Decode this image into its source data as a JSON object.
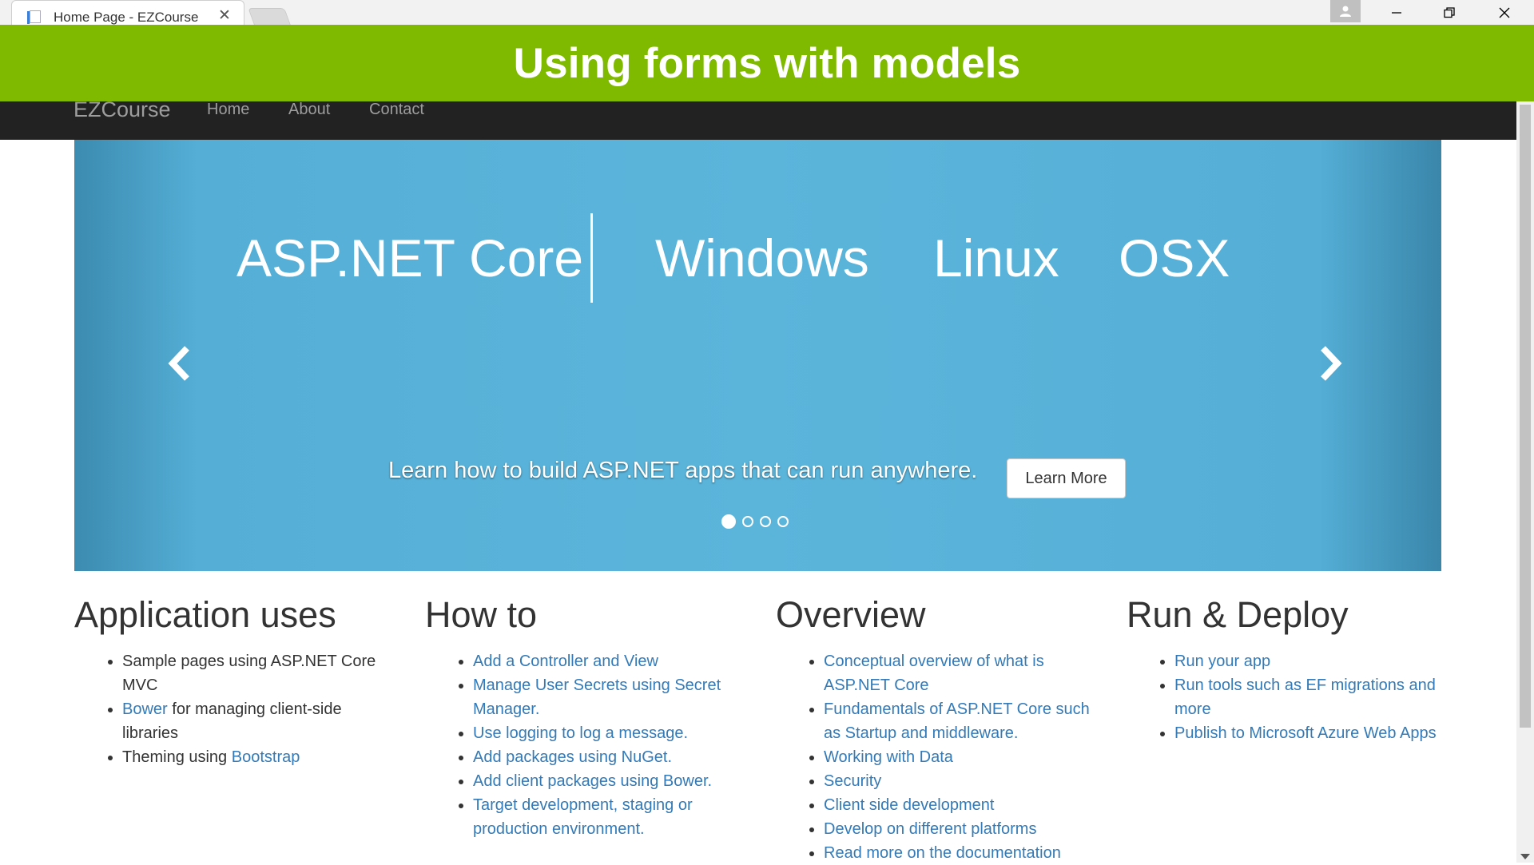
{
  "browser": {
    "tab_title": "Home Page - EZCourse",
    "tab_close": "✕"
  },
  "banner": {
    "title": "Using forms with models"
  },
  "navbar": {
    "brand": "EZCourse",
    "links": [
      "Home",
      "About",
      "Contact"
    ]
  },
  "carousel": {
    "headline": "ASP.NET Core",
    "platforms": [
      "Windows",
      "Linux",
      "OSX"
    ],
    "caption": "Learn how to build ASP.NET apps that can run anywhere.",
    "button_label": "Learn More",
    "slide_count": 4,
    "active_slide": 1
  },
  "sections": {
    "app_uses": {
      "title": "Application uses",
      "item1": "Sample pages using ASP.NET Core MVC",
      "item2_link": "Bower",
      "item2_rest": " for managing client-side libraries",
      "item3_text": "Theming using ",
      "item3_link": "Bootstrap"
    },
    "how_to": {
      "title": "How to",
      "items": [
        "Add a Controller and View",
        "Manage User Secrets using Secret Manager.",
        "Use logging to log a message.",
        "Add packages using NuGet.",
        "Add client packages using Bower.",
        "Target development, staging or production environment."
      ]
    },
    "overview": {
      "title": "Overview",
      "items": [
        "Conceptual overview of what is ASP.NET Core",
        "Fundamentals of ASP.NET Core such as Startup and middleware.",
        "Working with Data",
        "Security",
        "Client side development",
        "Develop on different platforms",
        "Read more on the documentation"
      ]
    },
    "run_deploy": {
      "title": "Run & Deploy",
      "items": [
        "Run your app",
        "Run tools such as EF migrations and more",
        "Publish to Microsoft Azure Web Apps"
      ]
    }
  },
  "colors": {
    "banner_green": "#7fba00",
    "navbar_bg": "#222222",
    "link_blue": "#337ab7",
    "carousel_blue": "#5bb5db"
  }
}
